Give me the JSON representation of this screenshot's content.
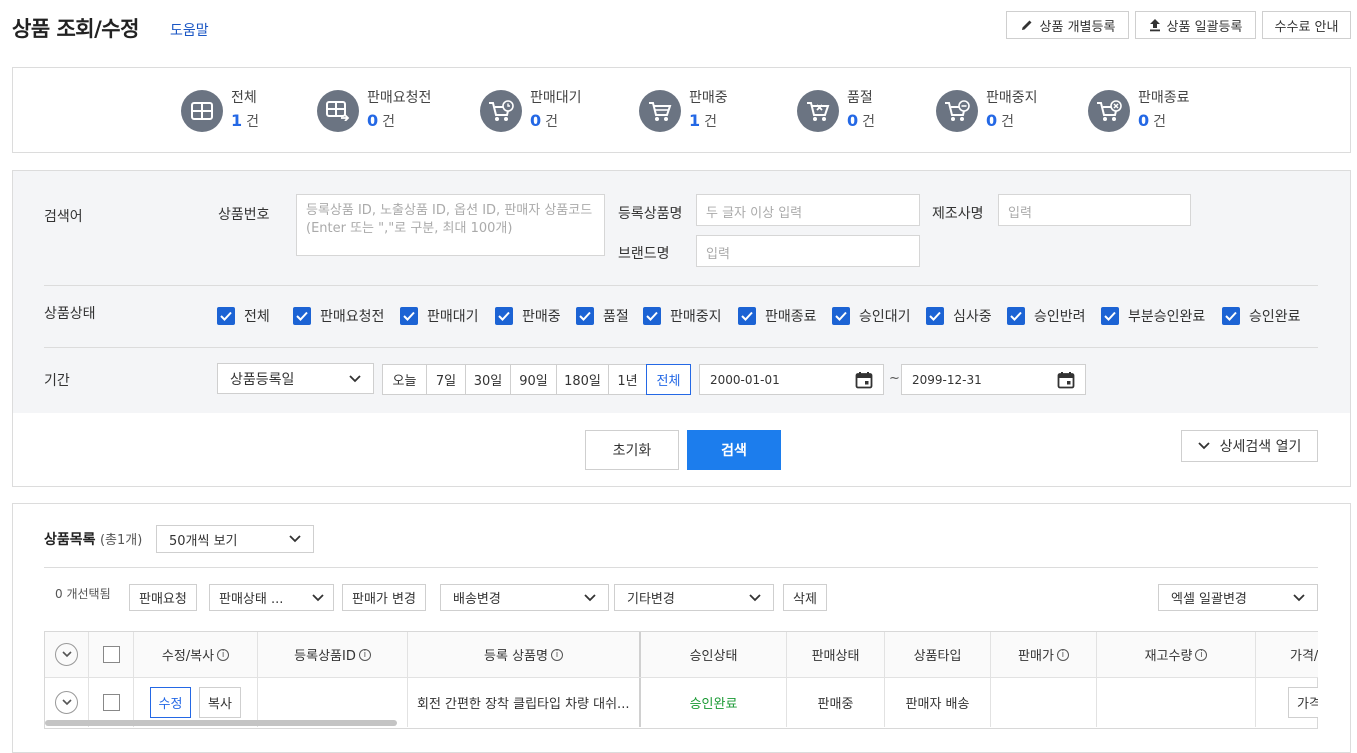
{
  "header": {
    "title": "상품 조회/수정",
    "help": "도움말",
    "btn_individual": "상품 개별등록",
    "btn_bulk": "상품 일괄등록",
    "btn_fee": "수수료 안내"
  },
  "summary": [
    {
      "label": "전체",
      "count": "1",
      "unit": "건",
      "icon": "grid-icon"
    },
    {
      "label": "판매요청전",
      "count": "0",
      "unit": "건",
      "icon": "grid-arrow-icon"
    },
    {
      "label": "판매대기",
      "count": "0",
      "unit": "건",
      "icon": "cart-clock-icon"
    },
    {
      "label": "판매중",
      "count": "1",
      "unit": "건",
      "icon": "cart-icon"
    },
    {
      "label": "품절",
      "count": "0",
      "unit": "건",
      "icon": "cart-x-icon"
    },
    {
      "label": "판매중지",
      "count": "0",
      "unit": "건",
      "icon": "cart-minus-icon"
    },
    {
      "label": "판매종료",
      "count": "0",
      "unit": "건",
      "icon": "cart-cancel-icon"
    }
  ],
  "search": {
    "keyword_label": "검색어",
    "product_no_label": "상품번호",
    "product_no_placeholder": "등록상품 ID, 노출상품 ID, 옵션 ID, 판매자 상품코드(Enter 또는 \",\"로 구분, 최대 100개)",
    "reg_name_label": "등록상품명",
    "reg_name_placeholder": "두 글자 이상 입력",
    "maker_label": "제조사명",
    "maker_placeholder": "입력",
    "brand_label": "브랜드명",
    "brand_placeholder": "입력",
    "status_label": "상품상태",
    "statuses": [
      "전체",
      "판매요청전",
      "판매대기",
      "판매중",
      "품절",
      "판매중지",
      "판매종료",
      "승인대기",
      "심사중",
      "승인반려",
      "부분승인완료",
      "승인완료"
    ],
    "period_label": "기간",
    "period_select": "상품등록일",
    "periods": [
      "오늘",
      "7일",
      "30일",
      "90일",
      "180일",
      "1년",
      "전체"
    ],
    "period_active": "전체",
    "date_from": "2000-01-01",
    "tilde": "~",
    "date_to": "2099-12-31",
    "reset": "초기화",
    "submit": "검색",
    "detail": "상세검색 열기"
  },
  "list": {
    "title": "상품목록",
    "total": "(총1개)",
    "per_page": "50개씩 보기",
    "selected": "0 개선택됨",
    "actions": {
      "request": "판매요청",
      "status_change": "판매상태 ...",
      "price_change": "판매가 변경",
      "shipping_change": "배송변경",
      "other_change": "기타변경",
      "delete": "삭제",
      "excel": "엑셀 일괄변경"
    },
    "columns": [
      "수정/복사",
      "등록상품ID",
      "등록 상품명",
      "승인상태",
      "판매상태",
      "상품타입",
      "판매가",
      "재고수량",
      "가격/"
    ],
    "row": {
      "edit": "수정",
      "copy": "복사",
      "id": "",
      "name": "회전 간편한 장착 클립타입 차량 대쉬...",
      "approval": "승인완료",
      "sale_status": "판매중",
      "type": "판매자 배송",
      "price": "",
      "stock": "",
      "price_btn": "가격"
    }
  },
  "colors": {
    "accent": "#1c7ded",
    "count_blue": "#2468e5",
    "approved_green": "#1a9a34",
    "icon_gray": "#6b7482"
  }
}
